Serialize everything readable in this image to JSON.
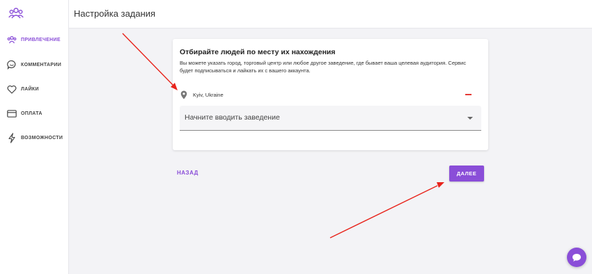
{
  "app": {
    "logo_icon": "people-group-icon",
    "accent_color": "#8a4ed8"
  },
  "header": {
    "title": "Настройка задания"
  },
  "sidebar": {
    "items": [
      {
        "label": "ПРИВЛЕЧЕНИЕ",
        "icon": "people-icon",
        "active": true
      },
      {
        "label": "КОММЕНТАРИИ",
        "icon": "comment-icon",
        "active": false
      },
      {
        "label": "ЛАЙКИ",
        "icon": "heart-icon",
        "active": false
      },
      {
        "label": "ОПЛАТА",
        "icon": "card-icon",
        "active": false
      },
      {
        "label": "ВОЗМОЖНОСТИ",
        "icon": "lightning-icon",
        "active": false
      }
    ]
  },
  "card": {
    "title": "Отбирайте людей по месту их нахождения",
    "description": "Вы можете указать город, торговый центр или любое другое заведение, где бывает ваша целевая аудитория. Сервис будет подписываться и лайкать их с вашего аккаунта.",
    "location": "Kyiv, Ukraine",
    "select_placeholder": "Начните вводить заведение"
  },
  "actions": {
    "back_label": "НАЗАД",
    "next_label": "ДАЛЕЕ"
  },
  "annotations": {
    "arrow_color": "#e8241c"
  }
}
